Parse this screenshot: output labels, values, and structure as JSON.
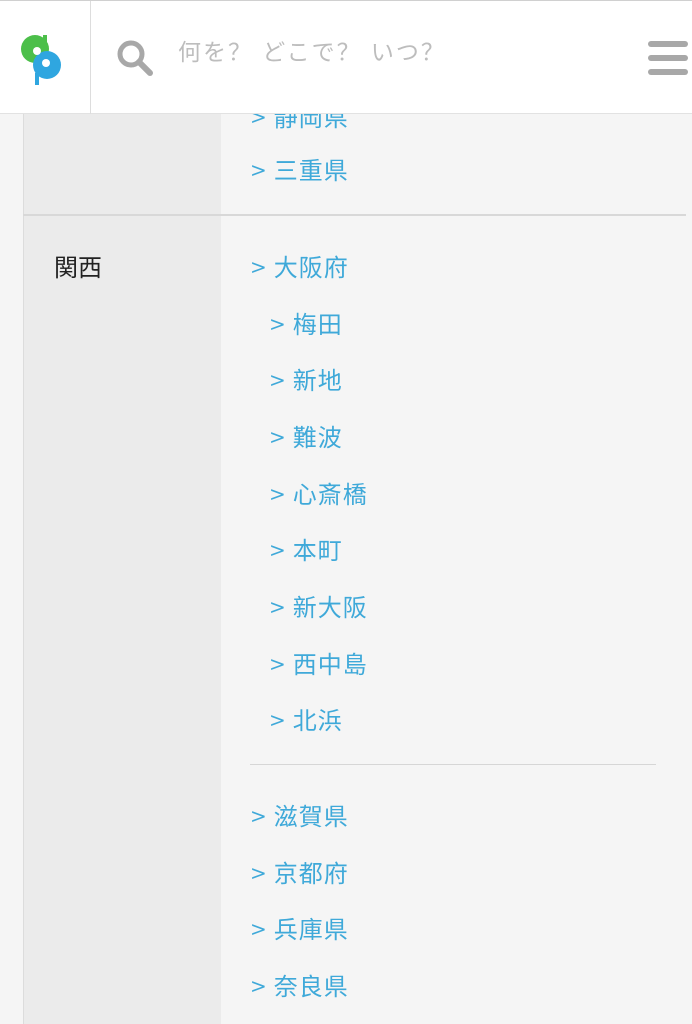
{
  "search": {
    "placeholder": "何を？ どこで？ いつ？"
  },
  "colors": {
    "link": "#3fa9d9",
    "logo_green": "#4cbf4a",
    "logo_blue": "#2fa6e0",
    "icon_gray": "#a8a8a8"
  },
  "icons": {
    "logo": "app-logo",
    "search": "search-icon",
    "menu": "hamburger-menu-icon",
    "chevron": "chevron-right-icon"
  },
  "prev_region": {
    "prefectures": [
      {
        "label": "静岡県"
      },
      {
        "label": "三重県"
      }
    ]
  },
  "kansai": {
    "label": "関西",
    "osaka": {
      "label": "大阪府",
      "areas": [
        {
          "label": "梅田"
        },
        {
          "label": "新地"
        },
        {
          "label": "難波"
        },
        {
          "label": "心斎橋"
        },
        {
          "label": "本町"
        },
        {
          "label": "新大阪"
        },
        {
          "label": "西中島"
        },
        {
          "label": "北浜"
        }
      ]
    },
    "prefectures": [
      {
        "label": "滋賀県"
      },
      {
        "label": "京都府"
      },
      {
        "label": "兵庫県"
      },
      {
        "label": "奈良県"
      }
    ]
  }
}
